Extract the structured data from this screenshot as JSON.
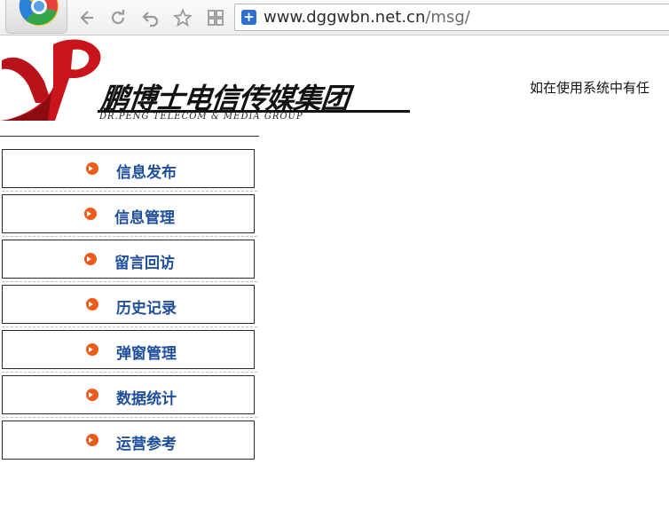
{
  "browser": {
    "url_host": "www.dggwbn.net.cn",
    "url_path": "/msg/",
    "icons": [
      "browser-logo-icon",
      "back-icon",
      "reload-icon",
      "undo-icon",
      "star-icon",
      "apps-icon",
      "site-shield-icon"
    ]
  },
  "header": {
    "brand_name": "鹏博士电信传媒集团",
    "brand_subtitle": "DR.PENG TELECOM & MEDIA GROUP",
    "notice": "如在使用系统中有任"
  },
  "menu": {
    "items": [
      {
        "label": "信息发布"
      },
      {
        "label": "信息管理"
      },
      {
        "label": "留言回访"
      },
      {
        "label": "历史记录"
      },
      {
        "label": "弹窗管理"
      },
      {
        "label": "数据统计"
      },
      {
        "label": "运营参考"
      }
    ]
  },
  "colors": {
    "menu_text": "#1f4f9a",
    "bullet": "#ee5a1a",
    "logo_red": "#c8141a"
  }
}
